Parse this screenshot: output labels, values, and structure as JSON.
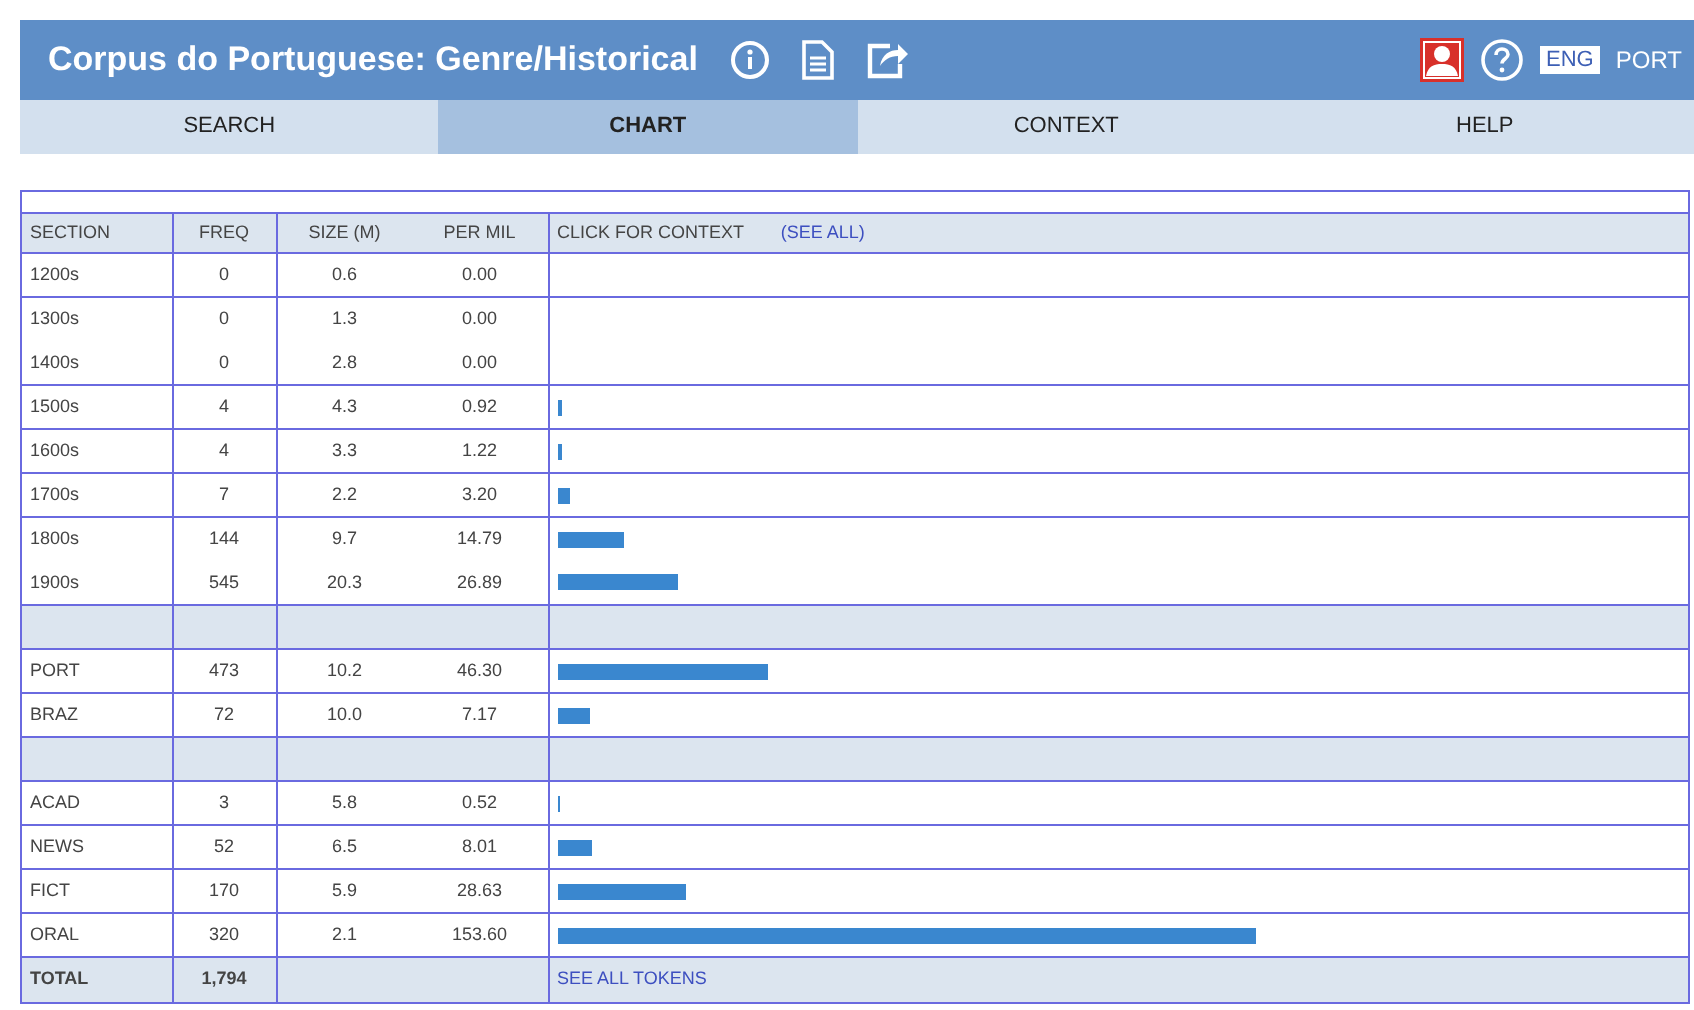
{
  "header": {
    "title": "Corpus do Portuguese: Genre/Historical",
    "languages": [
      {
        "label": "ENG",
        "selected": true
      },
      {
        "label": "PORT",
        "selected": false
      }
    ]
  },
  "tabs": [
    {
      "label": "SEARCH",
      "selected": false
    },
    {
      "label": "CHART",
      "selected": true
    },
    {
      "label": "CONTEXT",
      "selected": false
    },
    {
      "label": "HELP",
      "selected": false
    }
  ],
  "table": {
    "columns": [
      "SECTION",
      "FREQ",
      "SIZE (M)",
      "PER MIL",
      "CLICK FOR CONTEXT"
    ],
    "see_all": "(SEE ALL)",
    "blocks": [
      {
        "kind": "group",
        "rows": [
          {
            "section": "1200s",
            "freq": "0",
            "size": "0.6",
            "per_mil": "0.00"
          }
        ]
      },
      {
        "kind": "group",
        "rows": [
          {
            "section": "1300s",
            "freq": "0",
            "size": "1.3",
            "per_mil": "0.00"
          },
          {
            "section": "1400s",
            "freq": "0",
            "size": "2.8",
            "per_mil": "0.00"
          }
        ]
      },
      {
        "kind": "group",
        "rows": [
          {
            "section": "1500s",
            "freq": "4",
            "size": "4.3",
            "per_mil": "0.92",
            "level": 0.004
          }
        ]
      },
      {
        "kind": "group",
        "rows": [
          {
            "section": "1600s",
            "freq": "4",
            "size": "3.3",
            "per_mil": "1.22",
            "level": 0.004
          }
        ]
      },
      {
        "kind": "group",
        "rows": [
          {
            "section": "1700s",
            "freq": "7",
            "size": "2.2",
            "per_mil": "3.20",
            "level": 0.012
          }
        ]
      },
      {
        "kind": "group",
        "rows": [
          {
            "section": "1800s",
            "freq": "144",
            "size": "9.7",
            "per_mil": "14.79",
            "level": 0.06
          },
          {
            "section": "1900s",
            "freq": "545",
            "size": "20.3",
            "per_mil": "26.89",
            "level": 0.107
          }
        ]
      },
      {
        "kind": "spacer"
      },
      {
        "kind": "group",
        "rows": [
          {
            "section": "PORT",
            "freq": "473",
            "size": "10.2",
            "per_mil": "46.30",
            "level": 0.187
          }
        ]
      },
      {
        "kind": "group",
        "rows": [
          {
            "section": "BRAZ",
            "freq": "72",
            "size": "10.0",
            "per_mil": "7.17",
            "level": 0.029
          }
        ]
      },
      {
        "kind": "spacer"
      },
      {
        "kind": "group",
        "rows": [
          {
            "section": "ACAD",
            "freq": "3",
            "size": "5.8",
            "per_mil": "0.52",
            "level": 0.003
          }
        ]
      },
      {
        "kind": "group",
        "rows": [
          {
            "section": "NEWS",
            "freq": "52",
            "size": "6.5",
            "per_mil": "8.01",
            "level": 0.032
          }
        ]
      },
      {
        "kind": "group",
        "rows": [
          {
            "section": "FICT",
            "freq": "170",
            "size": "5.9",
            "per_mil": "28.63",
            "level": 0.115
          }
        ]
      },
      {
        "kind": "group",
        "rows": [
          {
            "section": "ORAL",
            "freq": "320",
            "size": "2.1",
            "per_mil": "153.60",
            "level": 0.622
          }
        ]
      }
    ],
    "total": {
      "label": "TOTAL",
      "freq": "1,794",
      "link": "SEE ALL TOKENS"
    }
  }
}
